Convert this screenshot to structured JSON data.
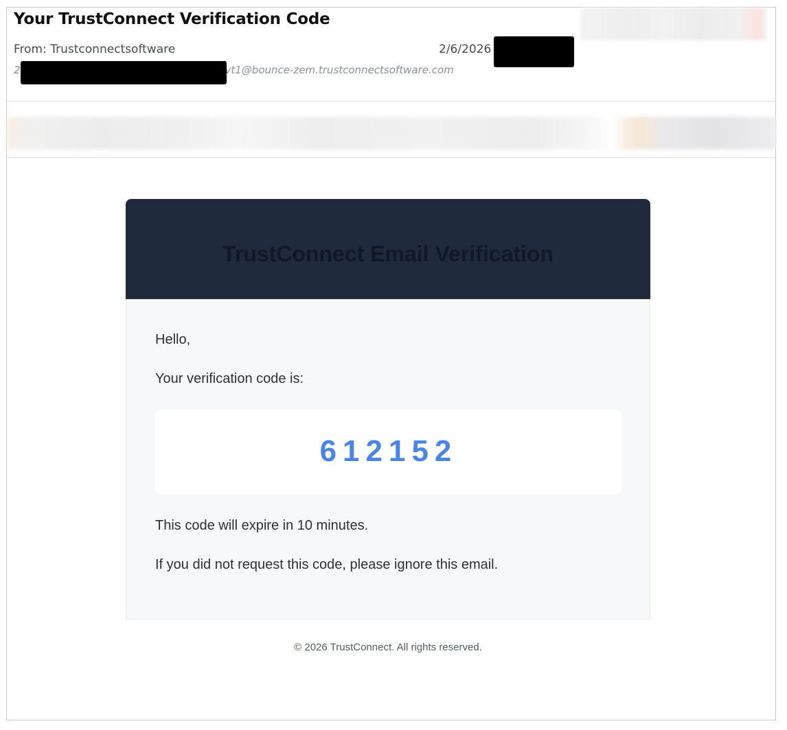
{
  "email": {
    "subject": "Your TrustConnect Verification Code",
    "from": "From: Trustconnectsoftware",
    "date": "2/6/2026",
    "sender_address_prefix": "2",
    "sender_address_suffix": "_vt1@bounce-zem.trustconnectsoftware.com"
  },
  "message": {
    "header_title": "TrustConnect Email Verification",
    "greeting": "Hello,",
    "intro": "Your verification code is:",
    "code": "612152",
    "expiry": "This code will expire in 10 minutes.",
    "ignore_notice": "If you did not request this code, please ignore this email.",
    "footer": "© 2026 TrustConnect. All rights reserved."
  },
  "colors": {
    "header_bg": "#1f2a3c",
    "header_text": "#111827",
    "code": "#4a84e6",
    "body_bg": "#f7f8fa"
  }
}
